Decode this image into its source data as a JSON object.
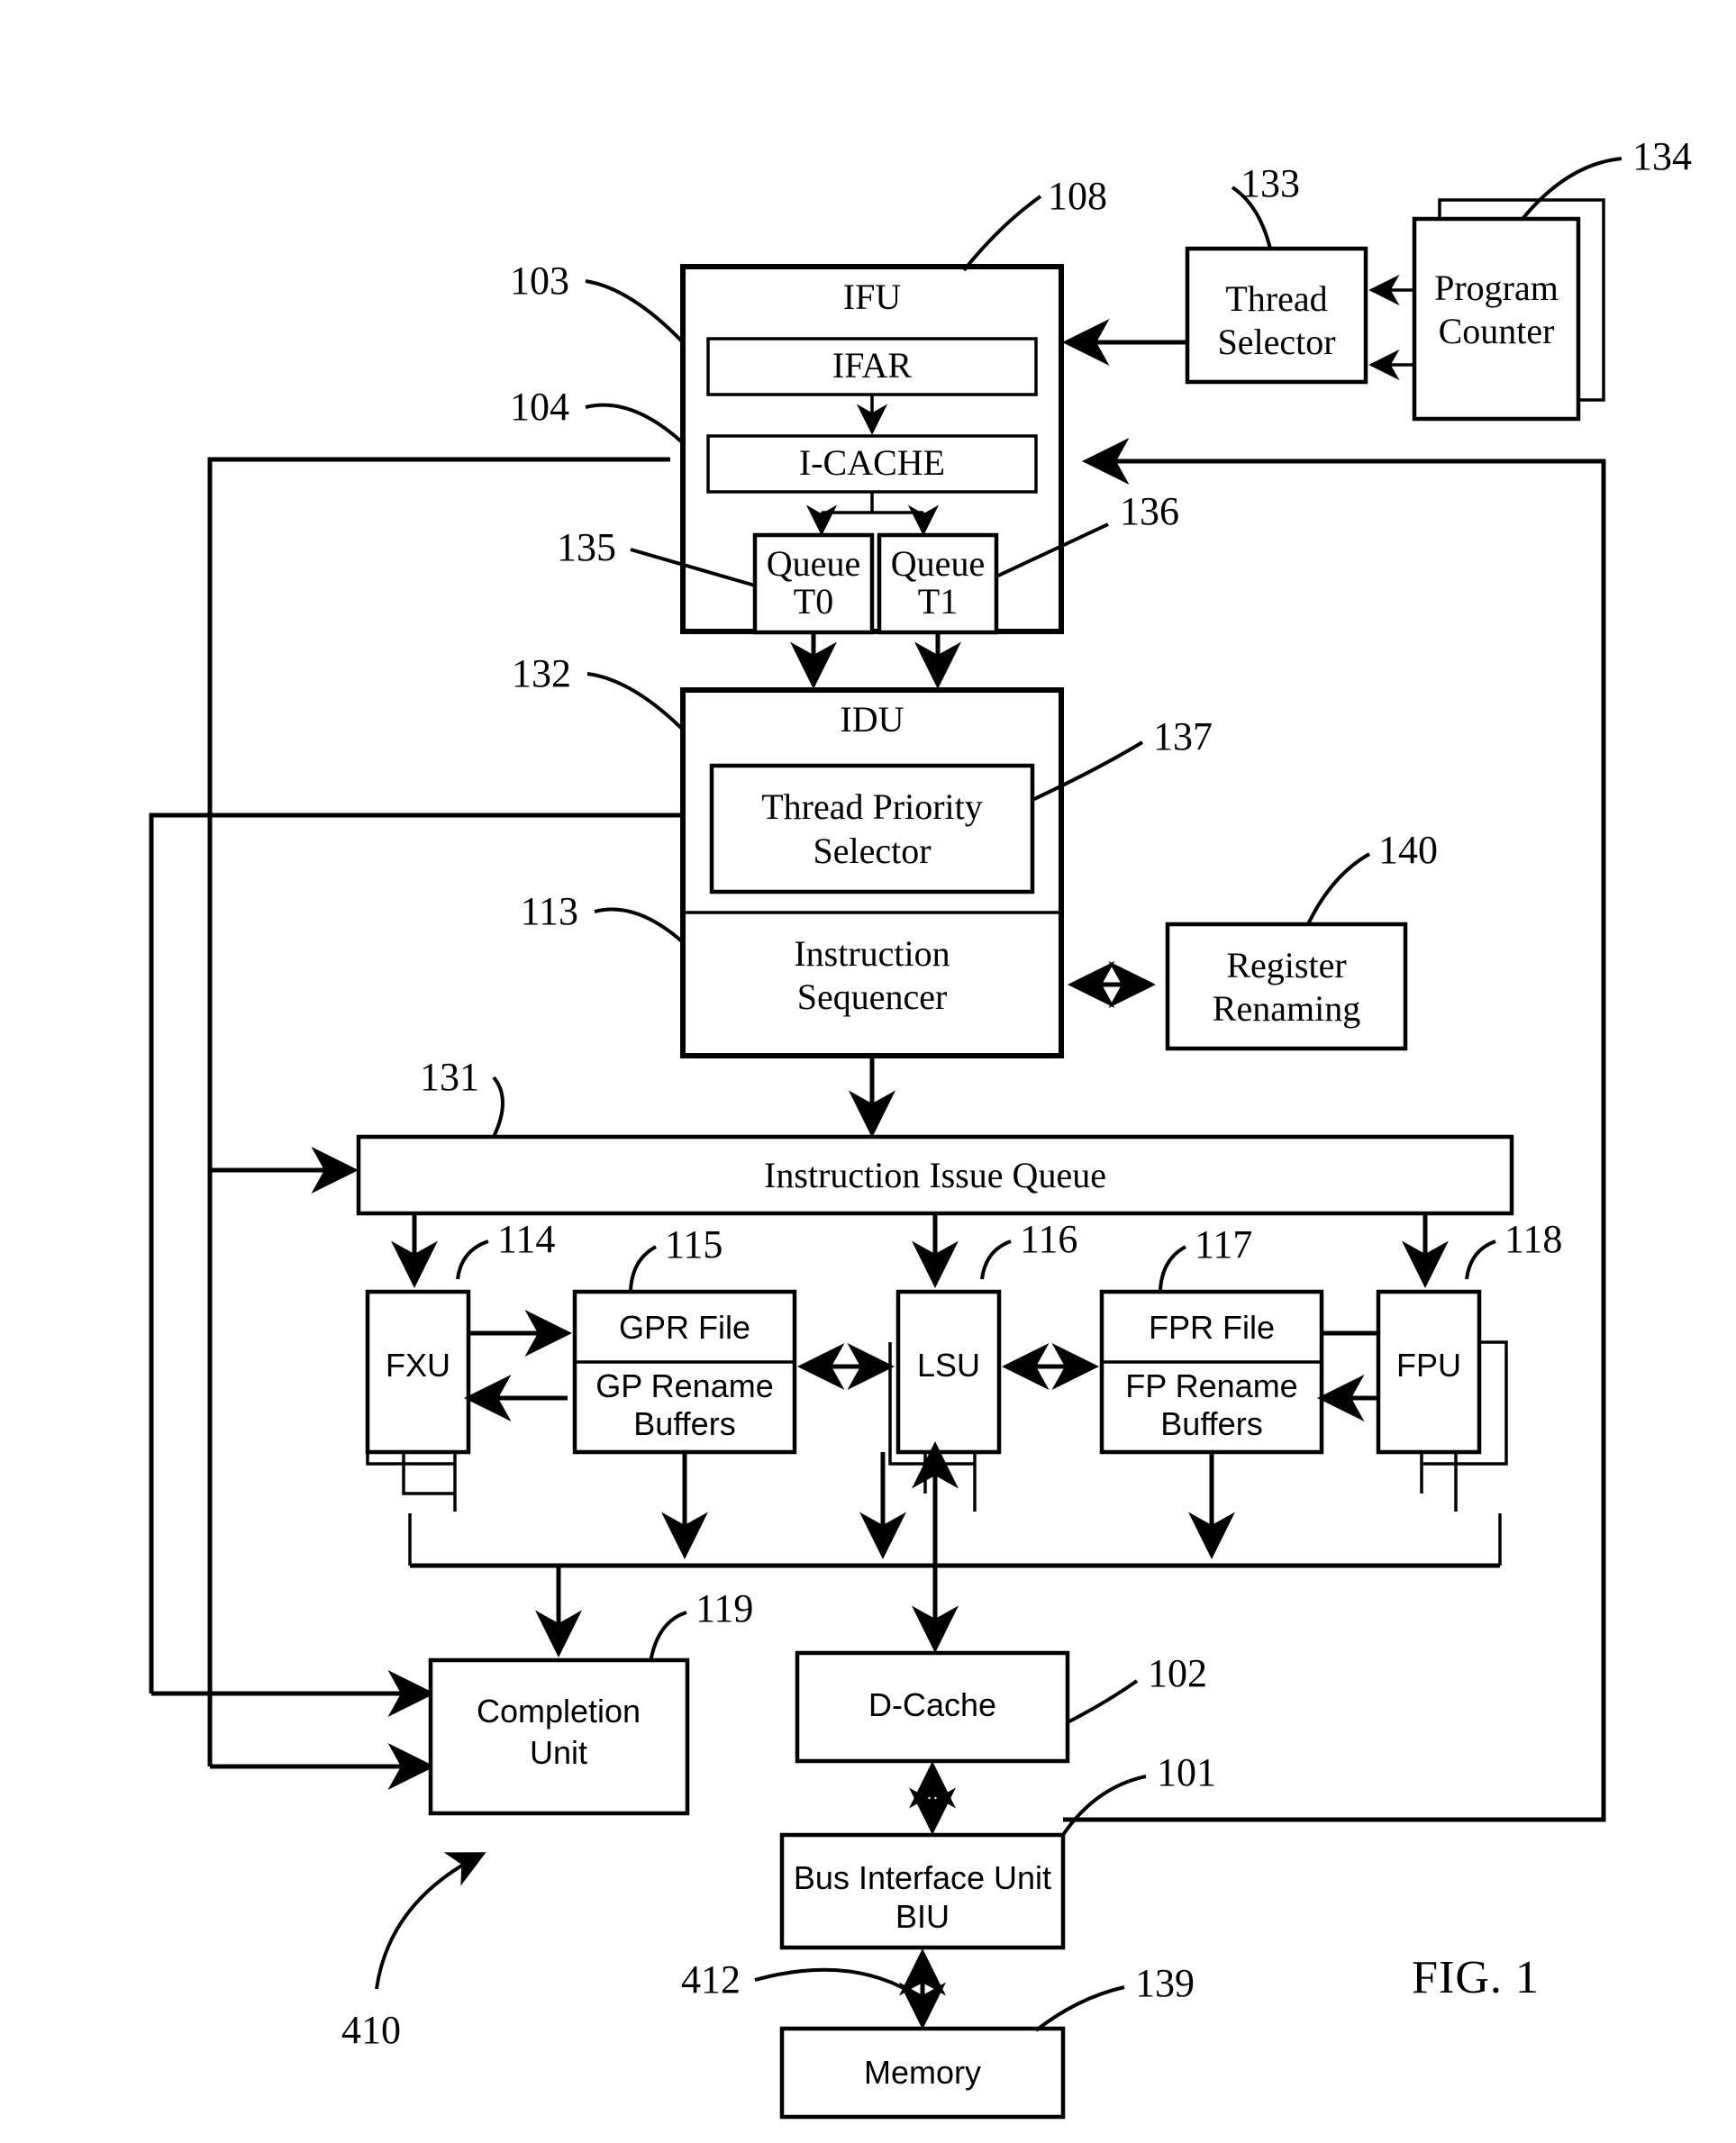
{
  "figure": {
    "caption": "FIG. 1",
    "system_ref": "410"
  },
  "blocks": {
    "ifu": {
      "label": "IFU",
      "ref": "108"
    },
    "ifar": {
      "label": "IFAR",
      "ref": "103"
    },
    "icache": {
      "label": "I-CACHE",
      "ref": "104"
    },
    "queue_t0": {
      "label_line1": "Queue",
      "label_line2": "T0",
      "ref": "135"
    },
    "queue_t1": {
      "label_line1": "Queue",
      "label_line2": "T1",
      "ref": "136"
    },
    "thread_selector": {
      "label_line1": "Thread",
      "label_line2": "Selector",
      "ref": "133"
    },
    "program_counter": {
      "label_line1": "Program",
      "label_line2": "Counter",
      "ref": "134"
    },
    "idu": {
      "label": "IDU",
      "ref": "132"
    },
    "thread_priority": {
      "label_line1": "Thread Priority",
      "label_line2": "Selector",
      "ref": "137"
    },
    "instr_sequencer": {
      "label_line1": "Instruction",
      "label_line2": "Sequencer",
      "ref": "113"
    },
    "register_rename": {
      "label_line1": "Register",
      "label_line2": "Renaming",
      "ref": "140"
    },
    "issue_queue": {
      "label": "Instruction Issue Queue",
      "ref": "131"
    },
    "fxu": {
      "label": "FXU",
      "ref": "114"
    },
    "gpr_file": {
      "label": "GPR File",
      "ref": "115"
    },
    "gp_rename": {
      "label_line1": "GP Rename",
      "label_line2": "Buffers"
    },
    "lsu": {
      "label": "LSU",
      "ref": "116"
    },
    "fpr_file": {
      "label": "FPR File",
      "ref": "117"
    },
    "fp_rename": {
      "label_line1": "FP Rename",
      "label_line2": "Buffers"
    },
    "fpu": {
      "label": "FPU",
      "ref": "118"
    },
    "completion_unit": {
      "label_line1": "Completion",
      "label_line2": "Unit",
      "ref": "119"
    },
    "dcache": {
      "label": "D-Cache",
      "ref": "102"
    },
    "biu": {
      "label_line1": "Bus Interface Unit",
      "label_line2": "BIU",
      "ref": "101"
    },
    "memory": {
      "label": "Memory",
      "ref": "139"
    },
    "bus_412": {
      "ref": "412"
    }
  },
  "colors": {
    "ink": "#000000",
    "paper": "#ffffff"
  }
}
